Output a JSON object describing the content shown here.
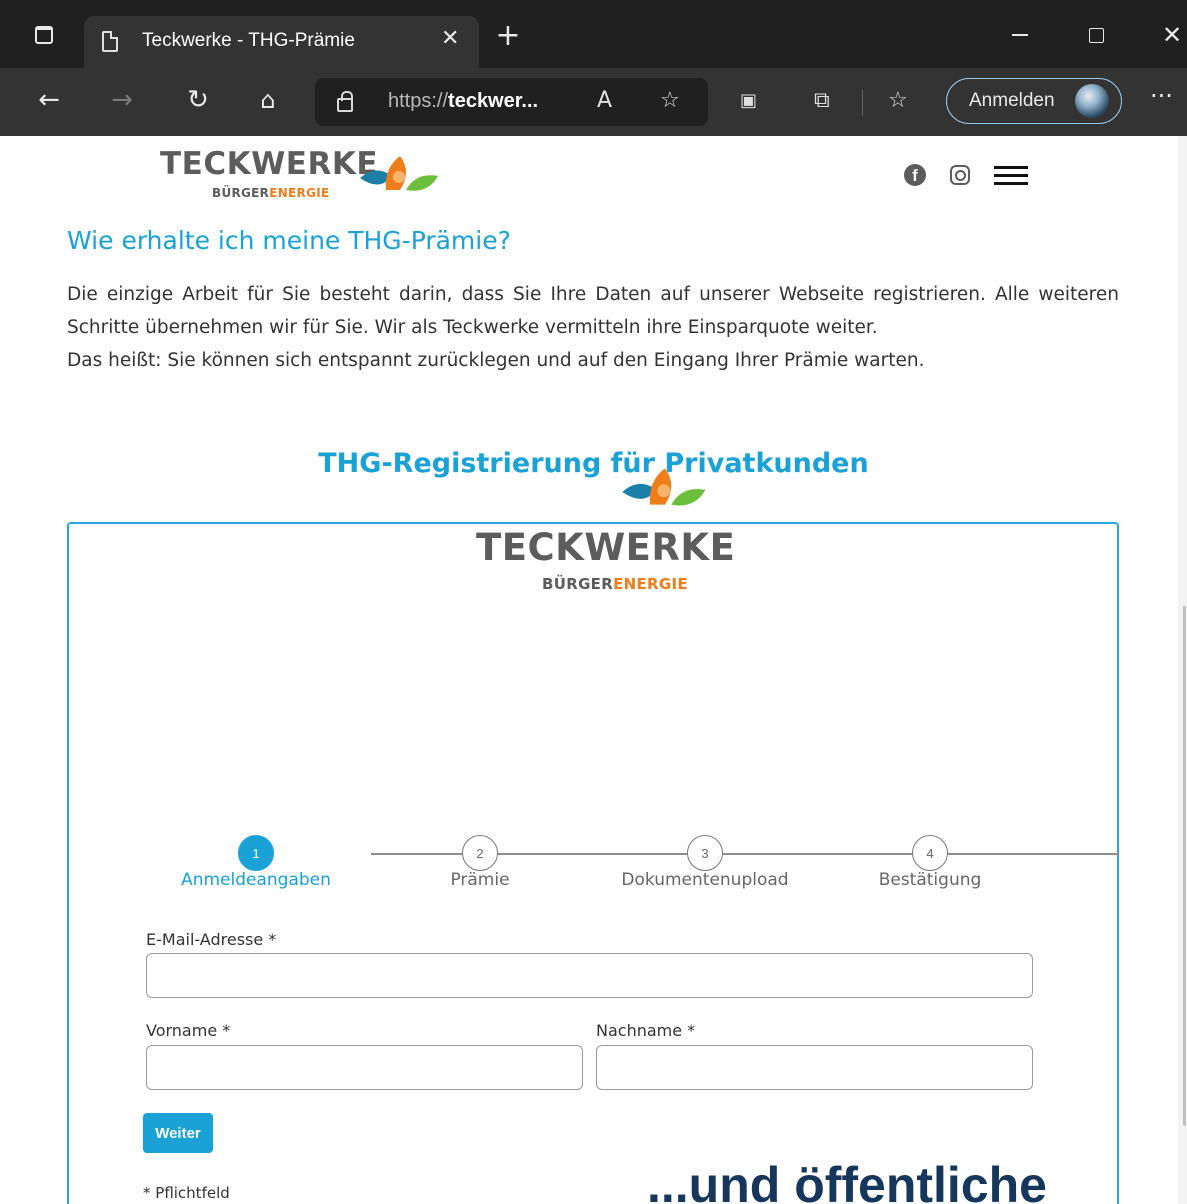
{
  "browser": {
    "tab_title": "Teckwerke - THG-Prämie",
    "url_prefix": "https://",
    "url_host": "teckwer...",
    "sign_in_label": "Anmelden"
  },
  "header": {
    "logo": {
      "word": "TECKWERKE",
      "sub_gray": "BÜRGER",
      "sub_orange": "ENERGIE"
    }
  },
  "intro": {
    "heading": "Wie erhalte ich meine THG-Prämie?",
    "paragraph_1": "Die einzige Arbeit für Sie besteht darin, dass Sie Ihre Daten auf unserer Webseite registrieren. Alle weiteren Schritte übernehmen wir für Sie. Wir als Teckwerke vermitteln ihre Einsparquote weiter.",
    "paragraph_2": "Das heißt: Sie können sich entspannt zurücklegen und auf den Eingang Ihrer Prämie warten."
  },
  "registration": {
    "heading": "THG-Registrierung für Privatkunden",
    "logo": {
      "word": "TECKWERKE",
      "sub_gray": "BÜRGER",
      "sub_orange": "ENERGIE"
    },
    "steps": [
      {
        "number": "1",
        "label": "Anmeldeangaben",
        "active": true
      },
      {
        "number": "2",
        "label": "Prämie",
        "active": false
      },
      {
        "number": "3",
        "label": "Dokumentenupload",
        "active": false
      },
      {
        "number": "4",
        "label": "Bestätigung",
        "active": false
      }
    ],
    "fields": {
      "email_label": "E-Mail-Adresse *",
      "email_value": "",
      "firstname_label": "Vorname *",
      "firstname_value": "",
      "lastname_label": "Nachname *",
      "lastname_value": ""
    },
    "next_button": "Weiter",
    "required_note": "* Pflichtfeld"
  },
  "caption": "...und öffentliche",
  "colors": {
    "accent": "#1aa1d6",
    "orange": "#ee7d1c",
    "caption": "#16365c"
  }
}
